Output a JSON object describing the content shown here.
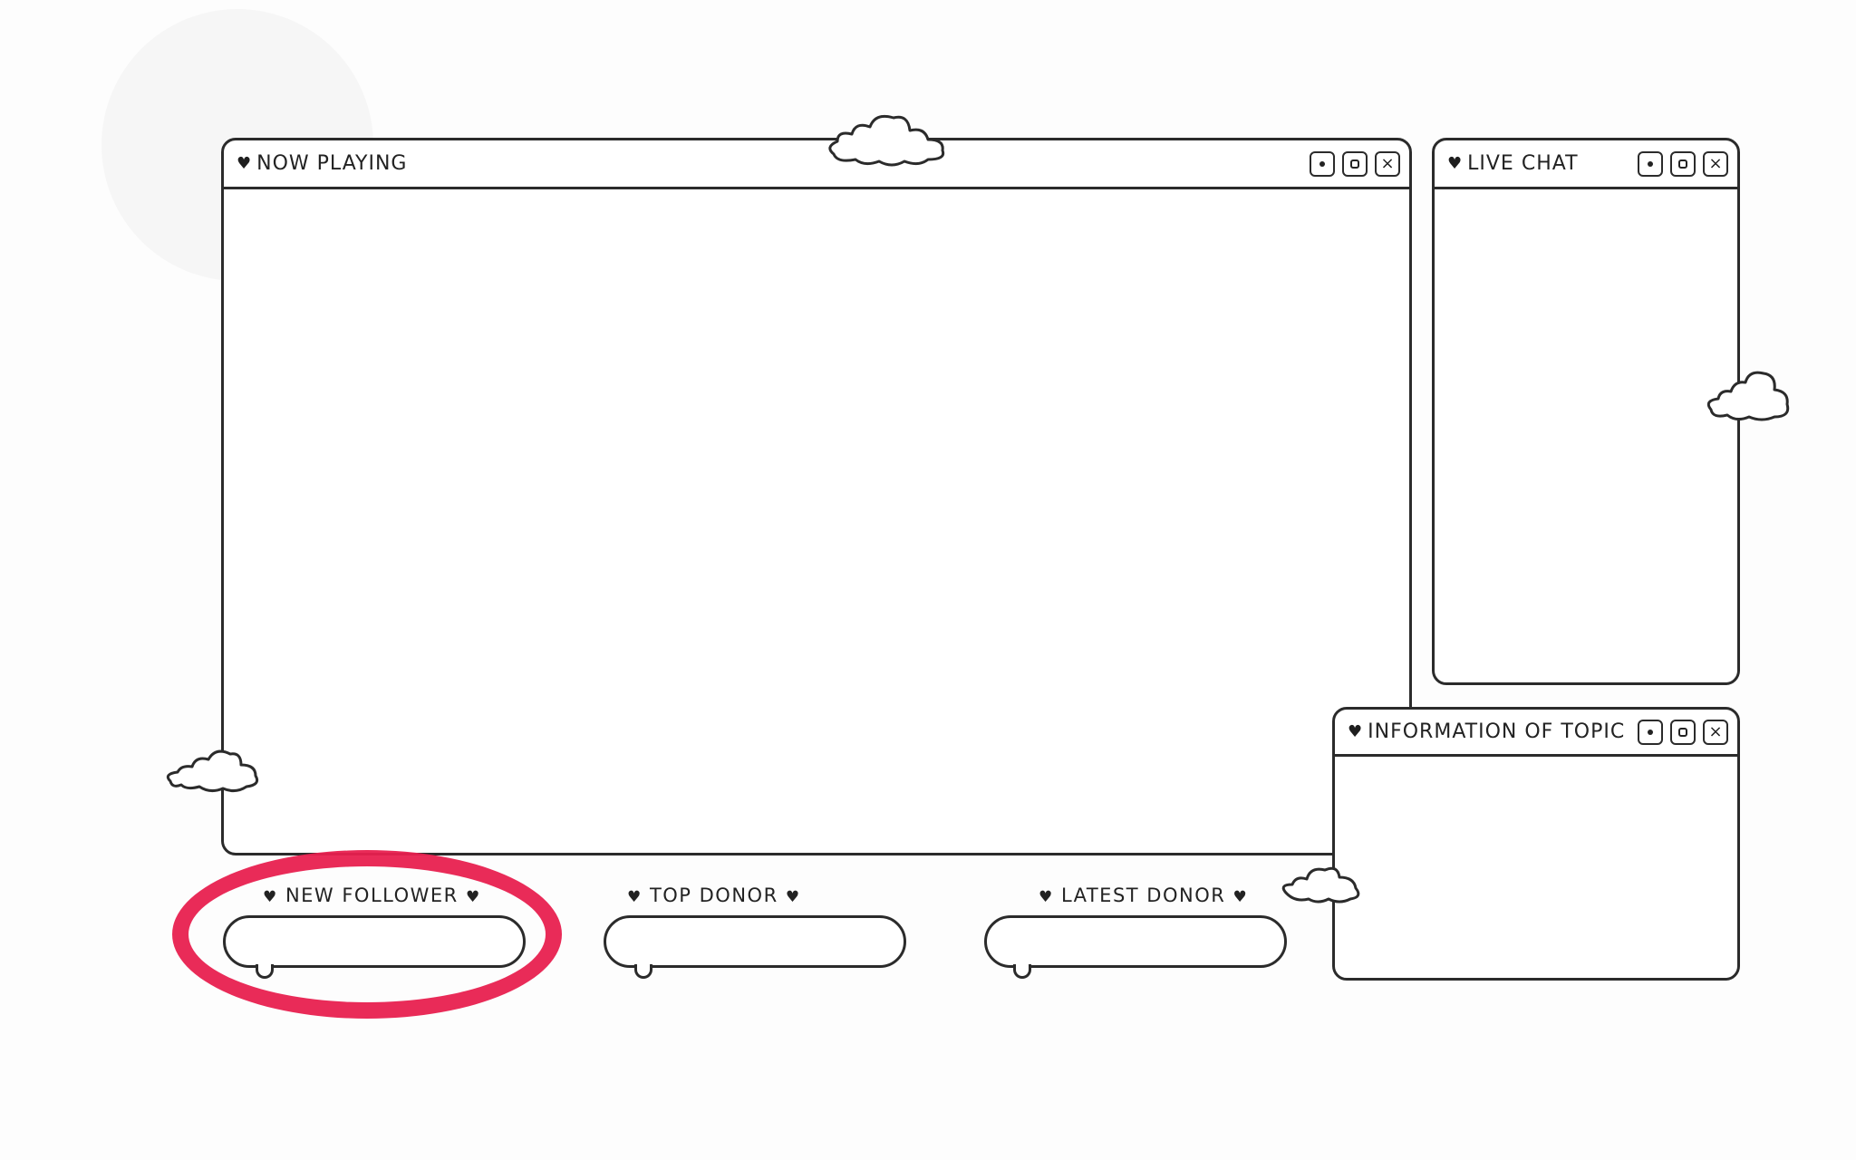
{
  "windows": {
    "now_playing": {
      "title": "NOW PLAYING"
    },
    "live_chat": {
      "title": "LIVE CHAT"
    },
    "info": {
      "title": "INFORMATION OF TOPIC"
    }
  },
  "heart_glyph": "♥",
  "close_glyph": "×",
  "alerts": [
    {
      "label": "NEW FOLLOWER"
    },
    {
      "label": "TOP DONOR"
    },
    {
      "label": "LATEST DONOR"
    }
  ],
  "colors": {
    "outline": "#2b2b2b",
    "highlight": "#e8204f",
    "background": "#fdfdfd"
  },
  "icons": [
    "heart-icon",
    "minimize-icon",
    "maximize-icon",
    "close-icon",
    "cloud-icon"
  ]
}
